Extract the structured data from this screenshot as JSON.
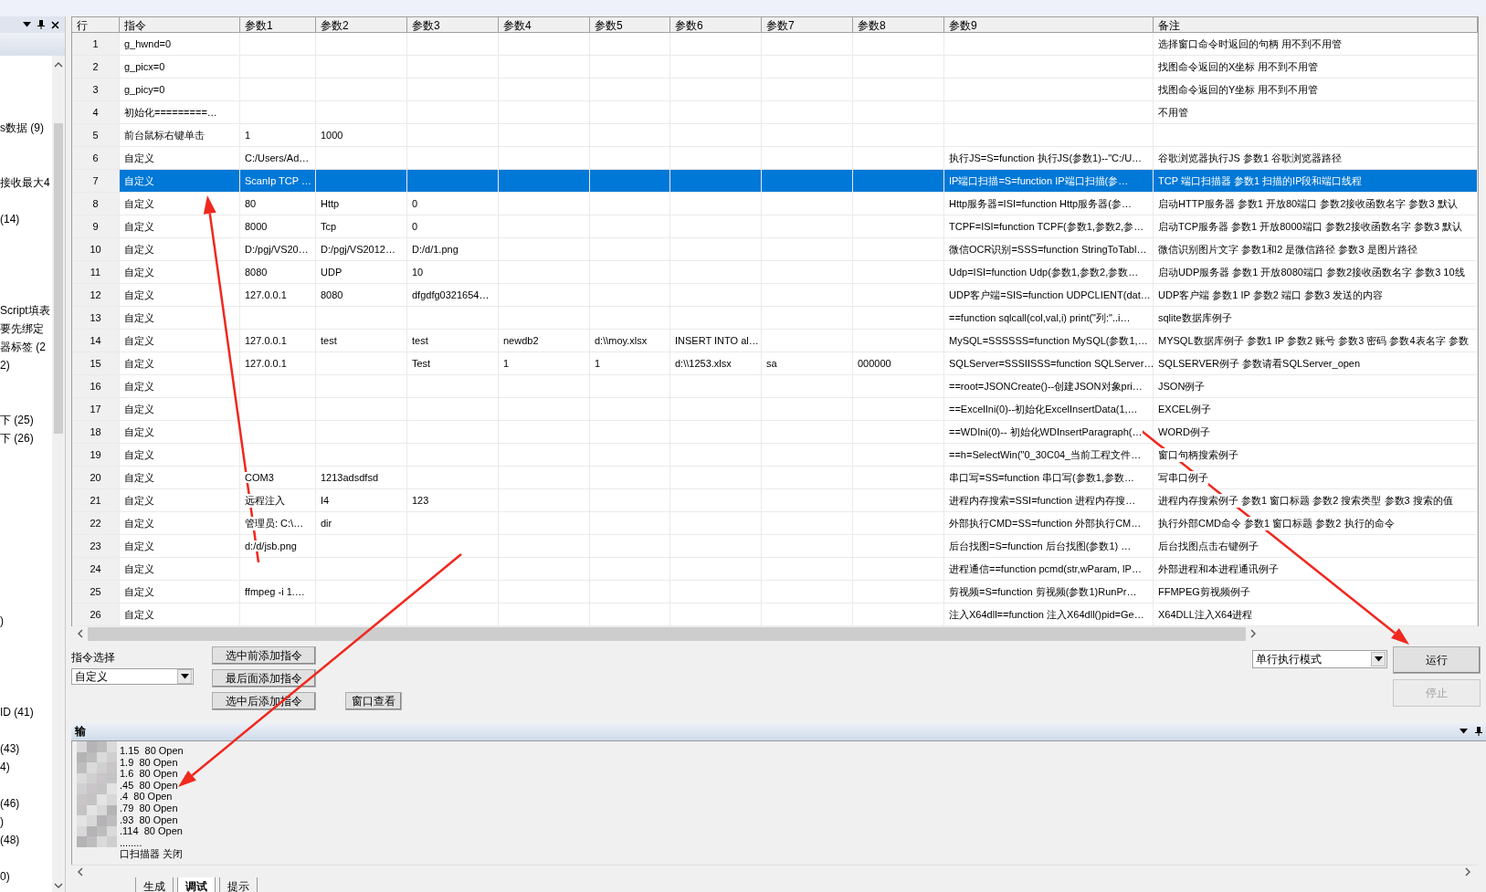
{
  "left_panel": {
    "items": [
      {
        "text": "s数据  (9)"
      },
      {
        "text": "接收最大4"
      },
      {
        "text": "(14)"
      },
      {
        "text": "Script填表"
      },
      {
        "text": "要先绑定"
      },
      {
        "text": "器标签  (2"
      },
      {
        "text": "2)"
      },
      {
        "text": "下  (25)"
      },
      {
        "text": "下  (26)"
      },
      {
        "text": ")"
      },
      {
        "text": "ID  (41)"
      },
      {
        "text": "(43)"
      },
      {
        "text": "4)"
      },
      {
        "text": "(46)"
      },
      {
        "text": ")"
      },
      {
        "text": "(48)"
      },
      {
        "text": "0)"
      }
    ]
  },
  "table": {
    "columns": [
      "行",
      "指令",
      "参数1",
      "参数2",
      "参数3",
      "参数4",
      "参数5",
      "参数6",
      "参数7",
      "参数8",
      "参数9",
      "备注"
    ],
    "rows": [
      {
        "selected": false,
        "cells": [
          "1",
          "g_hwnd=0",
          "",
          "",
          "",
          "",
          "",
          "",
          "",
          "",
          "",
          "选择窗口命令时返回的句柄 用不到不用管"
        ]
      },
      {
        "selected": false,
        "cells": [
          "2",
          "g_picx=0",
          "",
          "",
          "",
          "",
          "",
          "",
          "",
          "",
          "",
          "找图命令返回的X坐标 用不到不用管"
        ]
      },
      {
        "selected": false,
        "cells": [
          "3",
          "g_picy=0",
          "",
          "",
          "",
          "",
          "",
          "",
          "",
          "",
          "",
          "找图命令返回的Y坐标 用不到不用管"
        ]
      },
      {
        "selected": false,
        "cells": [
          "4",
          "初始化=========…",
          "",
          "",
          "",
          "",
          "",
          "",
          "",
          "",
          "",
          "不用管"
        ]
      },
      {
        "selected": false,
        "cells": [
          "5",
          "前台鼠标右键单击",
          "1",
          "1000",
          "",
          "",
          "",
          "",
          "",
          "",
          "",
          ""
        ]
      },
      {
        "selected": false,
        "cells": [
          "6",
          "自定义",
          "C:/Users/Ad…",
          "",
          "",
          "",
          "",
          "",
          "",
          "",
          "执行JS=S=function 执行JS(参数1)--\"C:/U…",
          "谷歌浏览器执行JS 参数1 谷歌浏览器路径"
        ]
      },
      {
        "selected": true,
        "cells": [
          "7",
          "自定义",
          "ScanIp TCP …",
          "",
          "",
          "",
          "",
          "",
          "",
          "",
          "IP端口扫描=S=function IP端口扫描(参…",
          "TCP 端口扫描器 参数1 扫描的IP段和端口线程"
        ]
      },
      {
        "selected": false,
        "cells": [
          "8",
          "自定义",
          "80",
          "Http",
          "0",
          "",
          "",
          "",
          "",
          "",
          "Http服务器=ISI=function Http服务器(参…",
          "启动HTTP服务器 参数1 开放80端口 参数2接收函数名字 参数3 默认"
        ]
      },
      {
        "selected": false,
        "cells": [
          "9",
          "自定义",
          "8000",
          "Tcp",
          "0",
          "",
          "",
          "",
          "",
          "",
          "TCPF=ISI=function TCPF(参数1,参数2,参…",
          "启动TCP服务器 参数1 开放8000端口 参数2接收函数名字 参数3 默认"
        ]
      },
      {
        "selected": false,
        "cells": [
          "10",
          "自定义",
          "D:/pgj/VS20…",
          "D:/pgj/VS2012…",
          "D:/d/1.png",
          "",
          "",
          "",
          "",
          "",
          "微信OCR识别=SSS=function StringToTabl…",
          "微信识别图片文字 参数1和2 是微信路径 参数3 是图片路径"
        ]
      },
      {
        "selected": false,
        "cells": [
          "11",
          "自定义",
          "8080",
          "UDP",
          "10",
          "",
          "",
          "",
          "",
          "",
          "Udp=ISI=function Udp(参数1,参数2,参数…",
          "启动UDP服务器 参数1 开放8080端口 参数2接收函数名字 参数3 10线"
        ]
      },
      {
        "selected": false,
        "cells": [
          "12",
          "自定义",
          "127.0.0.1",
          "8080",
          "dfgdfg0321654…",
          "",
          "",
          "",
          "",
          "",
          "UDP客户端=SIS=function UDPCLIENT(dat…",
          "UDP客户端 参数1 IP 参数2 端口 参数3 发送的内容"
        ]
      },
      {
        "selected": false,
        "cells": [
          "13",
          "自定义",
          "",
          "",
          "",
          "",
          "",
          "",
          "",
          "",
          "==function sqlcall(col,val,i)   print(\"列:\"..i…",
          "sqlite数据库例子"
        ]
      },
      {
        "selected": false,
        "cells": [
          "14",
          "自定义",
          "127.0.0.1",
          "test",
          "test",
          "newdb2",
          "d:\\\\moy.xlsx",
          "INSERT INTO al…",
          "",
          "",
          "MySQL=SSSSSS=function MySQL(参数1,…",
          "MYSQL数据库例子 参数1 IP 参数2 账号 参数3 密码 参数4表名字 参数"
        ]
      },
      {
        "selected": false,
        "cells": [
          "15",
          "自定义",
          "127.0.0.1",
          "",
          "Test",
          "1",
          "1",
          "d:\\\\1253.xlsx",
          "sa",
          "000000",
          "SQLServer=SSSIISSS=function SQLServer…",
          "SQLSERVER例子 参数请看SQLServer_open"
        ]
      },
      {
        "selected": false,
        "cells": [
          "16",
          "自定义",
          "",
          "",
          "",
          "",
          "",
          "",
          "",
          "",
          "==root=JSONCreate()--创建JSON对象pri…",
          "JSON例子"
        ]
      },
      {
        "selected": false,
        "cells": [
          "17",
          "自定义",
          "",
          "",
          "",
          "",
          "",
          "",
          "",
          "",
          "==ExcelIni(0)--初始化ExcelInsertData(1,…",
          "EXCEL例子"
        ]
      },
      {
        "selected": false,
        "cells": [
          "18",
          "自定义",
          "",
          "",
          "",
          "",
          "",
          "",
          "",
          "",
          "==WDIni(0)-- 初始化WDInsertParagraph(…",
          "WORD例子"
        ]
      },
      {
        "selected": false,
        "cells": [
          "19",
          "自定义",
          "",
          "",
          "",
          "",
          "",
          "",
          "",
          "",
          "==h=SelectWin(\"0_30C04_当前工程文件…",
          "窗口句柄搜索例子"
        ]
      },
      {
        "selected": false,
        "cells": [
          "20",
          "自定义",
          "COM3",
          "1213adsdfsd",
          "",
          "",
          "",
          "",
          "",
          "",
          "串口写=SS=function 串口写(参数1,参数…",
          "写串口例子"
        ]
      },
      {
        "selected": false,
        "cells": [
          "21",
          "自定义",
          "远程注入",
          "I4",
          "123",
          "",
          "",
          "",
          "",
          "",
          "进程内存搜索=SSI=function 进程内存搜…",
          "进程内存搜索例子 参数1 窗口标题 参数2 搜索类型 参数3 搜索的值"
        ]
      },
      {
        "selected": false,
        "cells": [
          "22",
          "自定义",
          "管理员: C:\\…",
          "dir",
          "",
          "",
          "",
          "",
          "",
          "",
          "外部执行CMD=SS=function 外部执行CM…",
          "执行外部CMD命令 参数1 窗口标题 参数2 执行的命令"
        ]
      },
      {
        "selected": false,
        "cells": [
          "23",
          "自定义",
          "d:/d/jsb.png",
          "",
          "",
          "",
          "",
          "",
          "",
          "",
          "后台找图=S=function 后台找图(参数1) …",
          "后台找图点击右键例子"
        ]
      },
      {
        "selected": false,
        "cells": [
          "24",
          "自定义",
          "",
          "",
          "",
          "",
          "",
          "",
          "",
          "",
          "进程通信==function pcmd(str,wParam, lP…",
          "外部进程和本进程通讯例子"
        ]
      },
      {
        "selected": false,
        "cells": [
          "25",
          "自定义",
          "ffmpeg -i 1.…",
          "",
          "",
          "",
          "",
          "",
          "",
          "",
          "剪视频=S=function 剪视频(参数1)RunPr…",
          "FFMPEG剪视频例子"
        ]
      },
      {
        "selected": false,
        "cells": [
          "26",
          "自定义",
          "",
          "",
          "",
          "",
          "",
          "",
          "",
          "",
          "注入X64dll==function 注入X64dll()pid=Ge…",
          "X64DLL注入X64进程"
        ]
      }
    ]
  },
  "command_select": {
    "label": "指令选择",
    "value": "自定义"
  },
  "add_buttons": [
    "选中前添加指令",
    "最后面添加指令",
    "选中后添加指令"
  ],
  "window_view_button": "窗口查看",
  "mode_select": {
    "value": "单行执行模式"
  },
  "run_buttons": [
    {
      "label": "运行",
      "disabled": false
    },
    {
      "label": "停止",
      "disabled": true
    }
  ],
  "output": {
    "title": "输",
    "lines": [
      "1.15  80 Open",
      "1.9  80 Open",
      "1.6  80 Open",
      ".45  80 Open",
      ".4  80 Open",
      ".79  80 Open",
      ".93  80 Open",
      ".114  80 Open",
      "........",
      "口扫描器 关闭"
    ]
  },
  "bottom_tabs": [
    {
      "label": "生成",
      "selected": false
    },
    {
      "label": "调试",
      "selected": true
    },
    {
      "label": "提示",
      "selected": false
    }
  ]
}
